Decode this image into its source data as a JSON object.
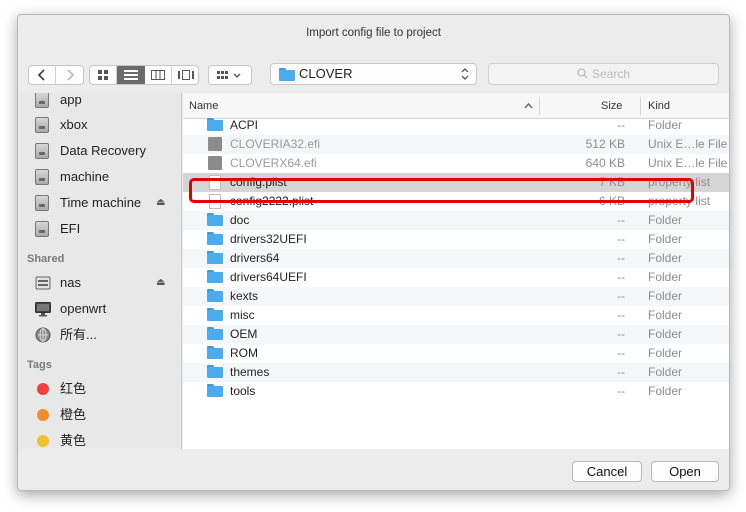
{
  "dialog": {
    "title": "Import config file to project"
  },
  "toolbar": {
    "back_icon": "chevron-left-icon",
    "forward_icon": "chevron-right-icon",
    "view_modes": [
      "icon-view-icon",
      "list-view-icon",
      "column-view-icon",
      "cover-flow-icon"
    ],
    "arrange_icon": "arrange-icon",
    "location": "CLOVER",
    "search_placeholder": "Search"
  },
  "sidebar": {
    "devices": [
      {
        "label": "app",
        "icon": "disk-icon",
        "eject": false
      },
      {
        "label": "xbox",
        "icon": "disk-icon",
        "eject": false
      },
      {
        "label": "Data Recovery",
        "icon": "disk-icon",
        "eject": false
      },
      {
        "label": "machine",
        "icon": "disk-icon",
        "eject": false
      },
      {
        "label": "Time machine",
        "icon": "time-machine-disk-icon",
        "eject": true
      },
      {
        "label": "EFI",
        "icon": "disk-icon",
        "eject": false
      }
    ],
    "shared_heading": "Shared",
    "shared": [
      {
        "label": "nas",
        "icon": "server-icon",
        "eject": true
      },
      {
        "label": "openwrt",
        "icon": "display-icon",
        "eject": false
      },
      {
        "label": "所有...",
        "icon": "network-icon",
        "eject": false
      }
    ],
    "tags_heading": "Tags",
    "tags": [
      {
        "label": "红色",
        "color": "#f0413c"
      },
      {
        "label": "橙色",
        "color": "#f28c2a"
      },
      {
        "label": "黄色",
        "color": "#f1c230"
      }
    ],
    "eject_glyph": "⏏"
  },
  "list": {
    "headers": {
      "name": "Name",
      "size": "Size",
      "kind": "Kind"
    },
    "files": [
      {
        "name": "ACPI",
        "size": "--",
        "kind": "Folder",
        "type": "folder"
      },
      {
        "name": "CLOVERIA32.efi",
        "size": "512 KB",
        "kind": "Unix E…le File",
        "type": "exe"
      },
      {
        "name": "CLOVERX64.efi",
        "size": "640 KB",
        "kind": "Unix E…le File",
        "type": "exe"
      },
      {
        "name": "config.plist",
        "size": "7 KB",
        "kind": "property list",
        "type": "doc",
        "selected": true
      },
      {
        "name": "config2222.plist",
        "size": "6 KB",
        "kind": "property list",
        "type": "doc"
      },
      {
        "name": "doc",
        "size": "--",
        "kind": "Folder",
        "type": "folder"
      },
      {
        "name": "drivers32UEFI",
        "size": "--",
        "kind": "Folder",
        "type": "folder"
      },
      {
        "name": "drivers64",
        "size": "--",
        "kind": "Folder",
        "type": "folder"
      },
      {
        "name": "drivers64UEFI",
        "size": "--",
        "kind": "Folder",
        "type": "folder"
      },
      {
        "name": "kexts",
        "size": "--",
        "kind": "Folder",
        "type": "folder"
      },
      {
        "name": "misc",
        "size": "--",
        "kind": "Folder",
        "type": "folder"
      },
      {
        "name": "OEM",
        "size": "--",
        "kind": "Folder",
        "type": "folder"
      },
      {
        "name": "ROM",
        "size": "--",
        "kind": "Folder",
        "type": "folder"
      },
      {
        "name": "themes",
        "size": "--",
        "kind": "Folder",
        "type": "folder"
      },
      {
        "name": "tools",
        "size": "--",
        "kind": "Folder",
        "type": "folder"
      }
    ]
  },
  "buttons": {
    "cancel": "Cancel",
    "open": "Open"
  },
  "colors": {
    "accent": "#4aabee",
    "highlight": "#e00000",
    "selection": "#d5d5d5"
  }
}
